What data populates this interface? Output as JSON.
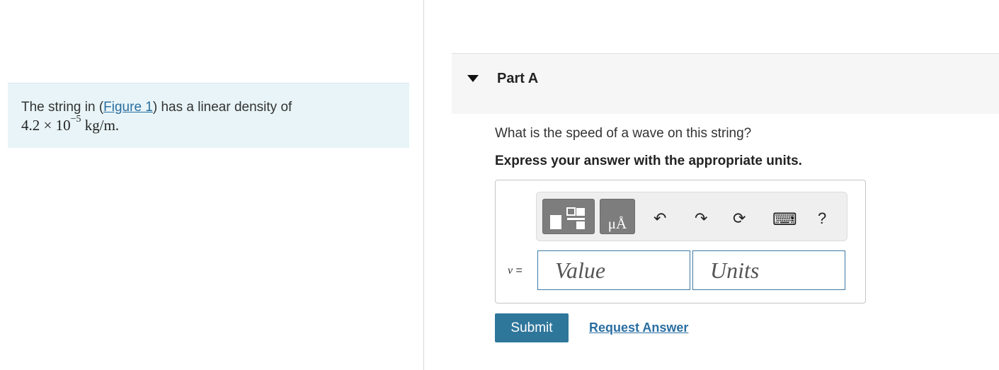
{
  "problem": {
    "text_before_link": "The string in (",
    "link": "Figure 1",
    "text_after_link": ") has a linear density of",
    "math_mantissa": "4.2 × 10",
    "math_exponent": "−5",
    "math_unit": " kg/m."
  },
  "part": {
    "title": "Part A",
    "question": "What is the speed of a wave on this string?",
    "instruction": "Express your answer with the appropriate units."
  },
  "toolbar": {
    "units_glyph": "μÅ",
    "undo": "↶",
    "redo": "↷",
    "reset": "⟳",
    "keyboard": "⌨",
    "help": "?"
  },
  "answer": {
    "variable": "v",
    "equals": " =",
    "value_placeholder": "Value",
    "units_placeholder": "Units"
  },
  "buttons": {
    "submit": "Submit",
    "request_answer": "Request Answer"
  },
  "colors": {
    "accent": "#2f769b",
    "link": "#2a6ea1",
    "problem_bg": "#e8f4f7"
  }
}
